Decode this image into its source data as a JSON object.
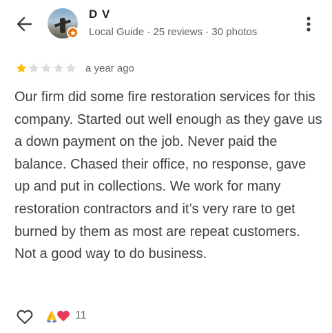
{
  "header": {
    "back_icon": "arrow-left-icon",
    "reviewer_name": "D V",
    "reviewer_meta": "Local Guide · 25 reviews · 30 photos",
    "local_guide_badge_icon": "star-badge-icon",
    "more_icon": "more-vertical-icon"
  },
  "review": {
    "rating": 1,
    "max_rating": 5,
    "star_filled_color": "#fbbc04",
    "star_empty_color": "#dadce0",
    "time": "a year ago",
    "text": "Our firm did some fire restoration services for this company. Started out well enough as they gave us a down payment on the job. Never paid the balance. Chased their office, no response, gave up and put in collections. We work for many restoration contractors and it’s very rare to get burned by them as most are repeat customers. Not a good way to do business."
  },
  "footer": {
    "like_icon": "heart-outline-icon",
    "reaction_icons": [
      "folded-hands-icon",
      "heart-icon"
    ],
    "reaction_count": "11"
  }
}
